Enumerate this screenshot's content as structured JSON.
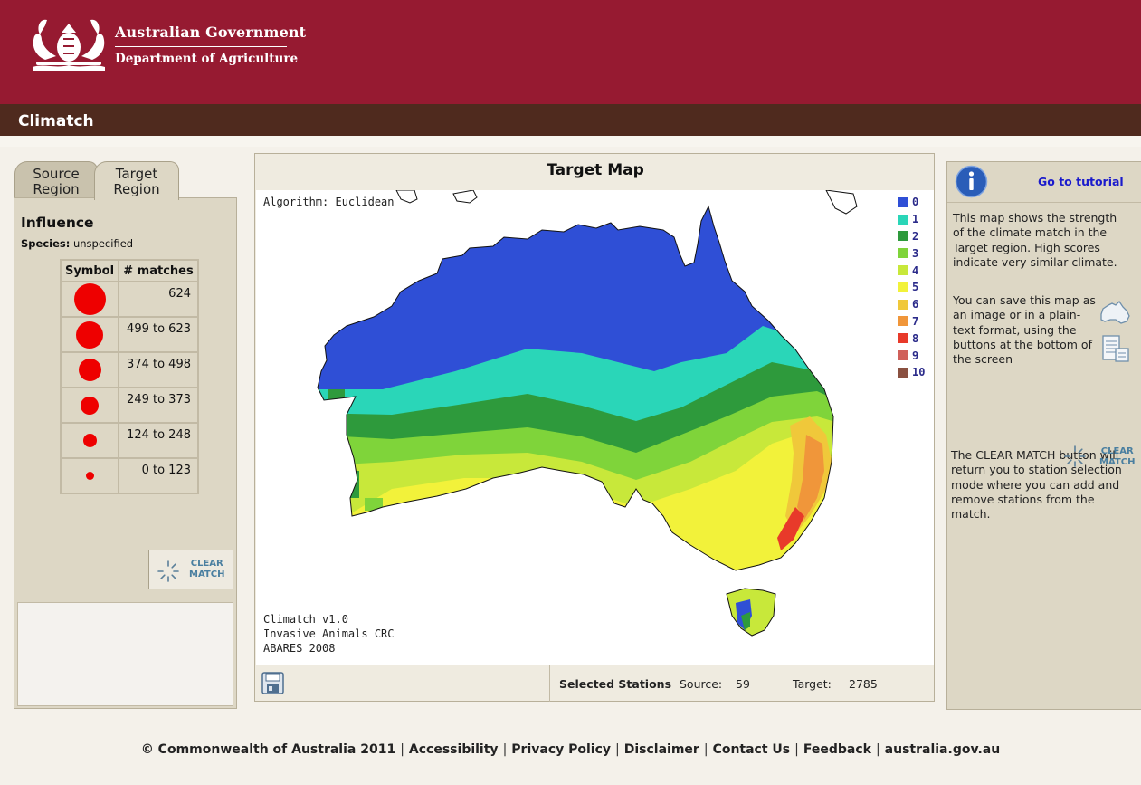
{
  "header": {
    "gov_line1": "Australian Government",
    "gov_line2": "Department of Agriculture",
    "app_title": "Climatch"
  },
  "left_panel": {
    "tabs": [
      {
        "label_line1": "Source",
        "label_line2": "Region",
        "active": false
      },
      {
        "label_line1": "Target",
        "label_line2": "Region",
        "active": true
      }
    ],
    "influence_title": "Influence",
    "species_label": "Species:",
    "species_value": "unspecified",
    "legend_headers": {
      "symbol": "Symbol",
      "matches": "# matches"
    },
    "legend_rows": [
      {
        "matches": "624"
      },
      {
        "matches": "499 to 623"
      },
      {
        "matches": "374 to 498"
      },
      {
        "matches": "249 to 373"
      },
      {
        "matches": "124 to 248"
      },
      {
        "matches": "0 to 123"
      }
    ],
    "clear_button": {
      "line1": "CLEAR",
      "line2": "MATCH"
    }
  },
  "map": {
    "title": "Target Map",
    "algorithm": "Algorithm: Euclidean",
    "credits": [
      "Climatch v1.0",
      "Invasive Animals CRC",
      "ABARES 2008"
    ],
    "scale": [
      {
        "label": "0",
        "color": "#2f4fd6"
      },
      {
        "label": "1",
        "color": "#2ad6b8"
      },
      {
        "label": "2",
        "color": "#2e9a3c"
      },
      {
        "label": "3",
        "color": "#7fd43a"
      },
      {
        "label": "4",
        "color": "#c8e83a"
      },
      {
        "label": "5",
        "color": "#f2f23a"
      },
      {
        "label": "6",
        "color": "#f0c83a"
      },
      {
        "label": "7",
        "color": "#f0963a"
      },
      {
        "label": "8",
        "color": "#e83a2a"
      },
      {
        "label": "9",
        "color": "#d0605a"
      },
      {
        "label": "10",
        "color": "#8a5040"
      }
    ],
    "stations": {
      "label": "Selected Stations",
      "source_label": "Source:",
      "source_value": "59",
      "target_label": "Target:",
      "target_value": "2785"
    }
  },
  "right_panel": {
    "tutorial_link": "Go to tutorial",
    "help1": "This map shows the strength of the climate match in the Target region.  High scores indicate very similar climate.",
    "help2": "You can save this map as an image or in a plain-text format, using the buttons at the bottom of the screen",
    "help3": "The CLEAR MATCH button will return you to station selection mode where you can add and remove stations from the match.",
    "clear_button": {
      "line1": "CLEAR",
      "line2": "MATCH"
    }
  },
  "footer": {
    "links": [
      "© Commonwealth of Australia 2011",
      "Accessibility",
      "Privacy Policy",
      "Disclaimer",
      "Contact Us",
      "Feedback",
      "australia.gov.au"
    ]
  }
}
